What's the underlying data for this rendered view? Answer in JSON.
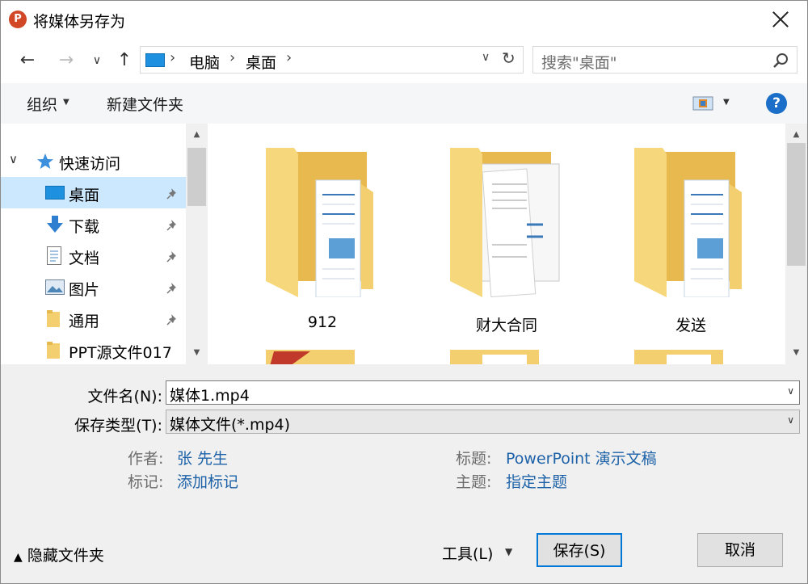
{
  "window": {
    "title": "将媒体另存为",
    "app_icon": "powerpoint-icon",
    "app_icon_letter": "P"
  },
  "nav": {
    "breadcrumb": [
      "电脑",
      "桌面"
    ],
    "search_placeholder": "搜索\"桌面\""
  },
  "toolbar": {
    "organize_label": "组织",
    "new_folder_label": "新建文件夹",
    "help_label": "?"
  },
  "sidebar": {
    "quick_access_label": "快速访问",
    "items": [
      {
        "label": "桌面",
        "icon": "desktop-icon",
        "pinned": true,
        "selected": true
      },
      {
        "label": "下载",
        "icon": "download-icon",
        "pinned": true
      },
      {
        "label": "文档",
        "icon": "document-icon",
        "pinned": true
      },
      {
        "label": "图片",
        "icon": "pictures-icon",
        "pinned": true
      },
      {
        "label": "通用",
        "icon": "folder-icon",
        "pinned": true
      },
      {
        "label": "PPT源文件017",
        "icon": "folder-icon",
        "pinned": false
      }
    ]
  },
  "files": [
    {
      "name": "912",
      "type": "folder"
    },
    {
      "name": "财大合同",
      "type": "folder"
    },
    {
      "name": "发送",
      "type": "folder"
    }
  ],
  "form": {
    "filename_label": "文件名(N):",
    "filename_value": "媒体1.mp4",
    "filetype_label": "保存类型(T):",
    "filetype_value": "媒体文件(*.mp4)"
  },
  "meta": {
    "author_label": "作者:",
    "author_value": "张 先生",
    "tags_label": "标记:",
    "tags_value": "添加标记",
    "title_label": "标题:",
    "title_value": "PowerPoint 演示文稿",
    "subject_label": "主题:",
    "subject_value": "指定主题"
  },
  "footer": {
    "hide_folders_label": "隐藏文件夹",
    "tools_label": "工具(L)",
    "save_label": "保存(S)",
    "cancel_label": "取消"
  },
  "colors": {
    "accent": "#0078d7",
    "selected_bg": "#cce8ff",
    "link": "#1d62a8",
    "folder": "#f3cf6f"
  }
}
